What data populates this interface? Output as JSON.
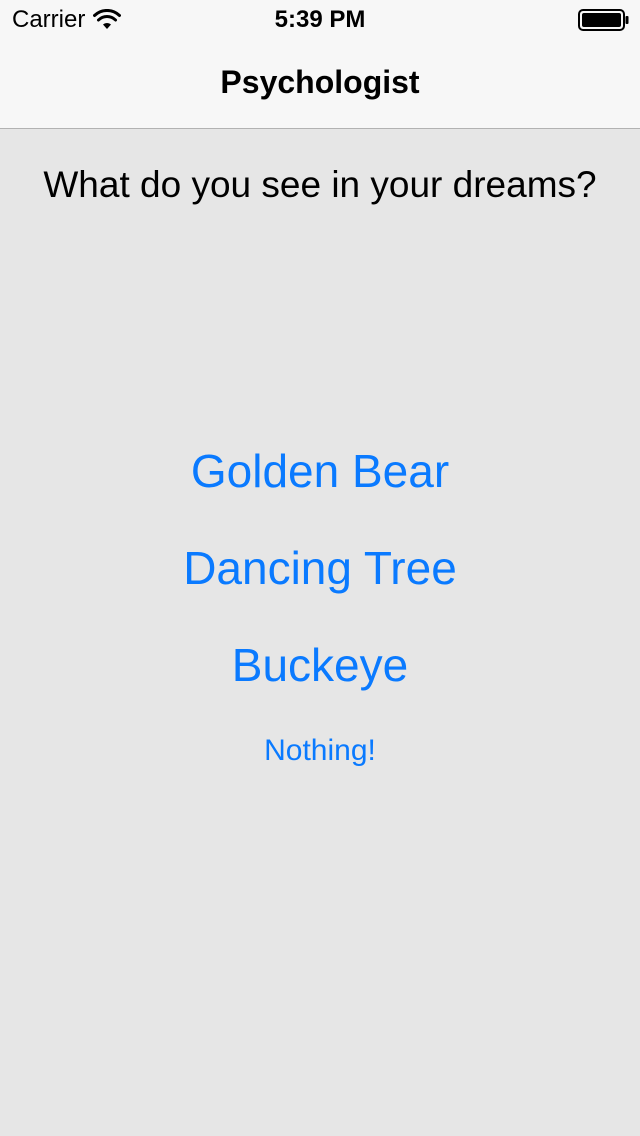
{
  "status_bar": {
    "carrier": "Carrier",
    "time": "5:39 PM",
    "icons": [
      "wifi-icon",
      "battery-icon"
    ]
  },
  "nav": {
    "title": "Psychologist"
  },
  "main": {
    "question": "What do you see in your dreams?",
    "choices": [
      {
        "label": "Golden Bear"
      },
      {
        "label": "Dancing Tree"
      },
      {
        "label": "Buckeye"
      },
      {
        "label": "Nothing!"
      }
    ]
  },
  "colors": {
    "accent": "#0a7aff",
    "background": "#e6e6e6",
    "bar_background": "#f7f7f7"
  }
}
